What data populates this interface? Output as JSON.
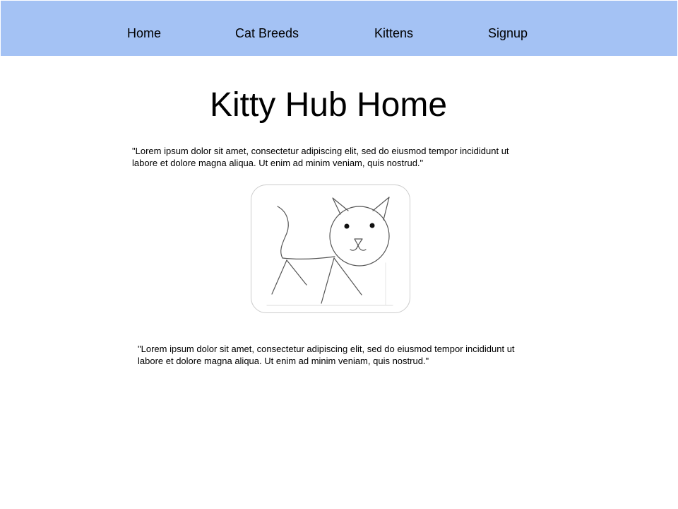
{
  "nav": {
    "items": [
      {
        "label": "Home"
      },
      {
        "label": "Cat Breeds"
      },
      {
        "label": "Kittens"
      },
      {
        "label": "Signup"
      }
    ],
    "background_color": "#a4c2f4"
  },
  "main": {
    "title": "Kitty Hub Home",
    "intro_text": "\"Lorem ipsum dolor sit amet, consectetur adipiscing elit, sed do eiusmod tempor incididunt ut labore et dolore magna aliqua. Ut enim ad minim veniam, quis nostrud.\"",
    "image_icon": "cat-drawing-icon",
    "outro_text": "\"Lorem ipsum dolor sit amet, consectetur adipiscing elit, sed do eiusmod tempor incididunt ut labore et dolore magna aliqua. Ut enim ad minim veniam, quis nostrud.\""
  }
}
